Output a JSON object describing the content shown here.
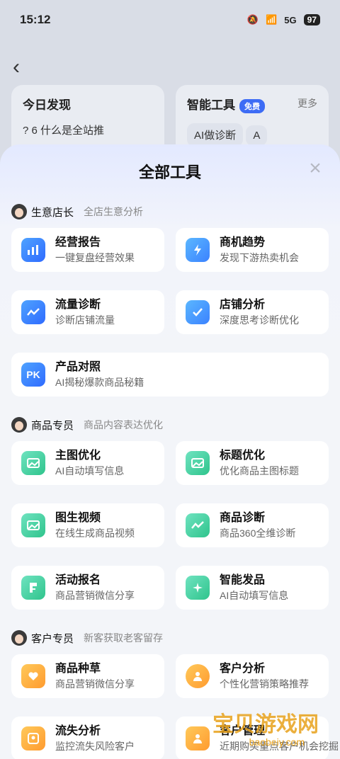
{
  "status": {
    "time": "15:12",
    "battery": "97",
    "signal": "5G"
  },
  "background": {
    "left_card": {
      "title": "今日发现",
      "row": "?   6  什么是全站推"
    },
    "right_card": {
      "title": "智能工具",
      "badge": "免费",
      "more": "更多",
      "chip1": "AI做诊断",
      "chip2": "A"
    }
  },
  "sheet": {
    "title": "全部工具",
    "close": "×"
  },
  "sections": [
    {
      "name": "生意店长",
      "desc": "全店生意分析",
      "tools": [
        {
          "title": "经营报告",
          "sub": "一键复盘经营效果",
          "icon": "bar-chart-icon"
        },
        {
          "title": "商机趋势",
          "sub": "发现下游热卖机会",
          "icon": "lightning-drop-icon"
        },
        {
          "title": "流量诊断",
          "sub": "诊断店铺流量",
          "icon": "trend-shop-icon"
        },
        {
          "title": "店铺分析",
          "sub": "深度思考诊断优化",
          "icon": "clipboard-check-icon"
        },
        {
          "title": "产品对照",
          "sub": "AI揭秘爆款商品秘籍",
          "icon": "pk-icon",
          "icon_text": "PK"
        }
      ]
    },
    {
      "name": "商品专员",
      "desc": "商品内容表达优化",
      "tools": [
        {
          "title": "主图优化",
          "sub": "AI自动填写信息",
          "icon": "image-icon"
        },
        {
          "title": "标题优化",
          "sub": "优化商品主图标题",
          "icon": "image-icon"
        },
        {
          "title": "图生视频",
          "sub": "在线生成商品视频",
          "icon": "image-icon"
        },
        {
          "title": "商品诊断",
          "sub": "商品360全维诊断",
          "icon": "trend-search-icon"
        },
        {
          "title": "活动报名",
          "sub": "商品营销微信分享",
          "icon": "flag-doc-icon"
        },
        {
          "title": "智能发品",
          "sub": "AI自动填写信息",
          "icon": "sparkle-bag-icon"
        }
      ]
    },
    {
      "name": "客户专员",
      "desc": "新客获取老客留存",
      "tools": [
        {
          "title": "商品种草",
          "sub": "商品营销微信分享",
          "icon": "heart-bag-icon"
        },
        {
          "title": "客户分析",
          "sub": "个性化营销策略推荐",
          "icon": "user-circle-icon"
        },
        {
          "title": "流失分析",
          "sub": "监控流失风险客户",
          "icon": "user-scan-icon"
        },
        {
          "title": "客户管理",
          "sub": "近期购买重点客户机会挖掘",
          "icon": "user-hex-icon"
        }
      ]
    }
  ],
  "watermark": {
    "text": "宝贝游戏网",
    "sub": "baobeiy.com"
  }
}
